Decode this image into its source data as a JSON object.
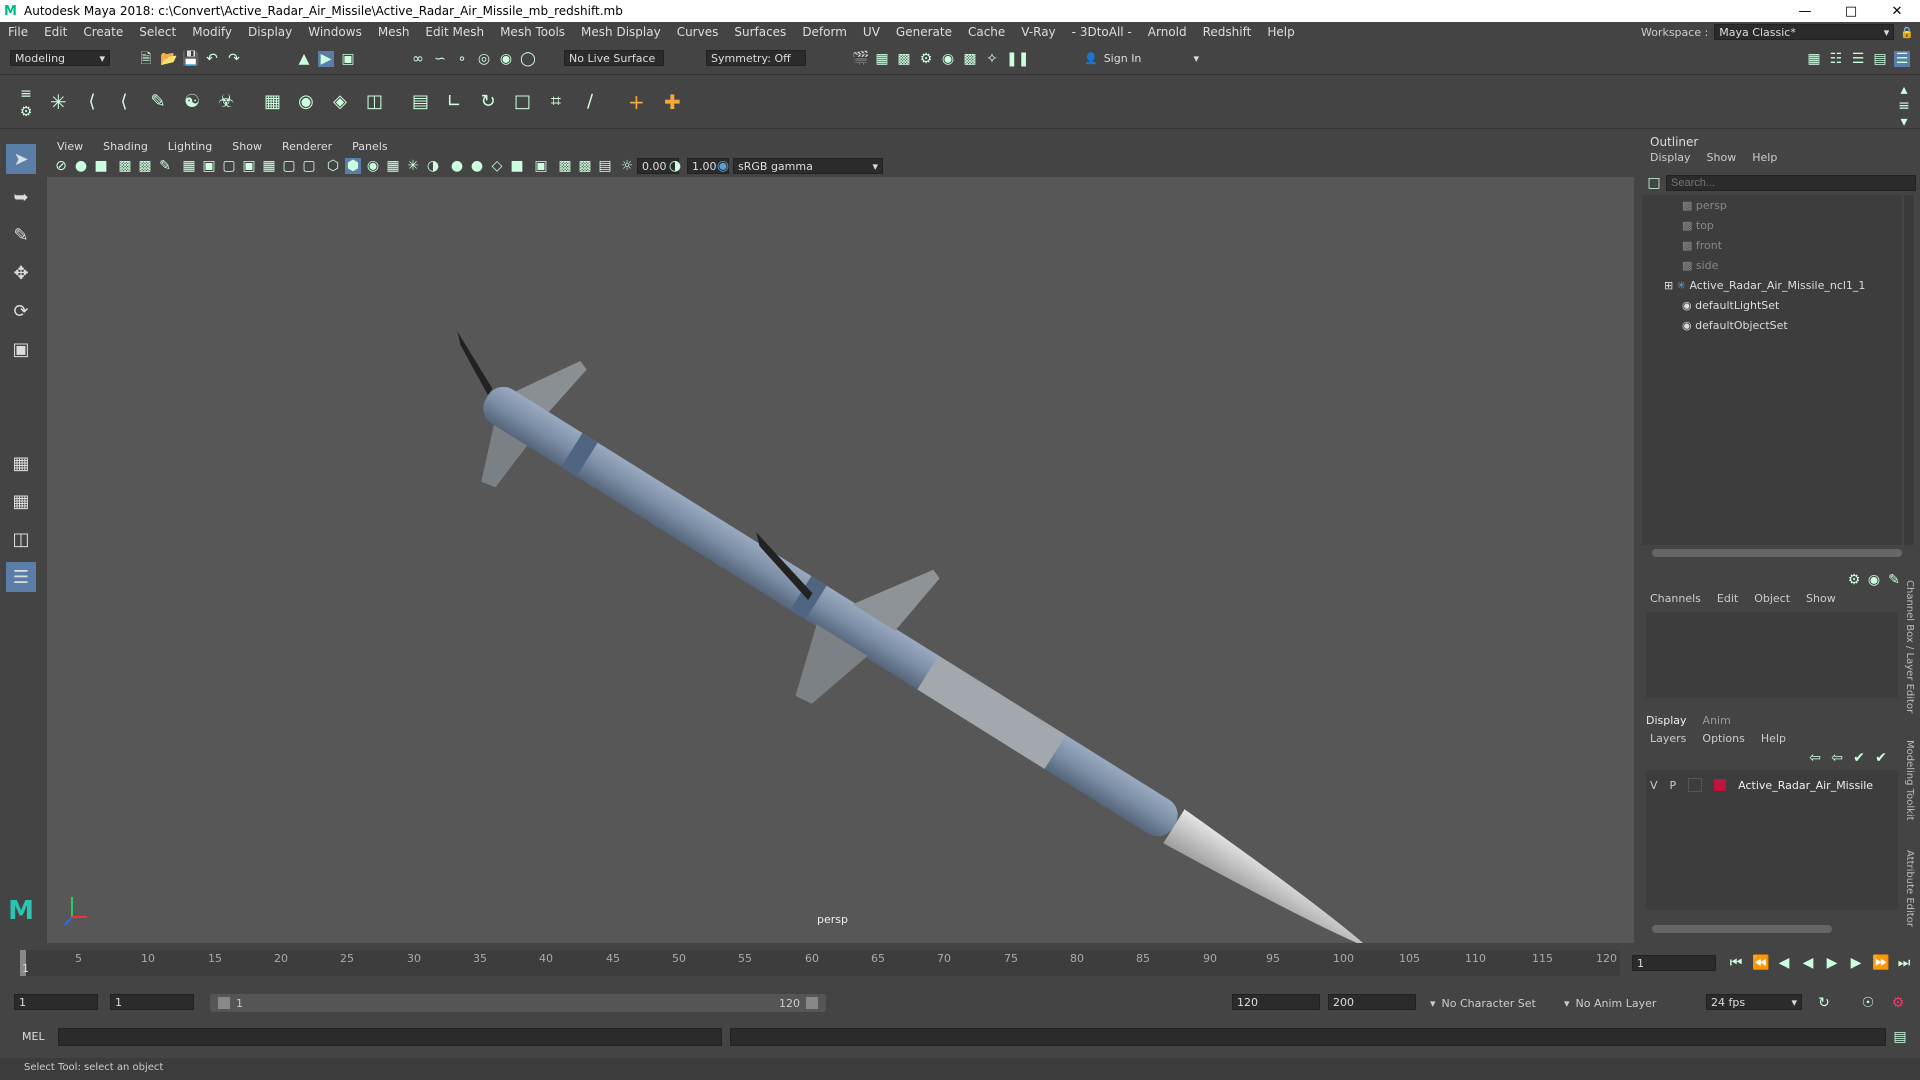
{
  "window": {
    "title": "Autodesk Maya 2018: c:\\Convert\\Active_Radar_Air_Missile\\Active_Radar_Air_Missile_mb_redshift.mb",
    "logo": "M"
  },
  "menus": [
    "File",
    "Edit",
    "Create",
    "Select",
    "Modify",
    "Display",
    "Windows",
    "Mesh",
    "Edit Mesh",
    "Mesh Tools",
    "Mesh Display",
    "Curves",
    "Surfaces",
    "Deform",
    "UV",
    "Generate",
    "Cache",
    "V-Ray",
    "- 3DtoAll -",
    "Arnold",
    "Redshift",
    "Help"
  ],
  "workspace": {
    "label": "Workspace :",
    "value": "Maya Classic*"
  },
  "status_line": {
    "mode": "Modeling",
    "live_surface": "No Live Surface",
    "symmetry": "Symmetry: Off",
    "sign_in": "Sign In"
  },
  "viewport": {
    "menu": [
      "View",
      "Shading",
      "Lighting",
      "Show",
      "Renderer",
      "Panels"
    ],
    "exposure": "0.00",
    "gamma": "1.00",
    "color_space": "sRGB gamma",
    "camera_label": "persp"
  },
  "outliner": {
    "title": "Outliner",
    "menu": [
      "Display",
      "Show",
      "Help"
    ],
    "search_placeholder": "Search...",
    "items": [
      "persp",
      "top",
      "front",
      "side",
      "Active_Radar_Air_Missile_ncl1_1",
      "defaultLightSet",
      "defaultObjectSet"
    ]
  },
  "channel_box": {
    "menu": [
      "Channels",
      "Edit",
      "Object",
      "Show"
    ]
  },
  "layer_editor": {
    "tabs": [
      "Display",
      "Anim"
    ],
    "menu": [
      "Layers",
      "Options",
      "Help"
    ],
    "layer": {
      "v": "V",
      "p": "P",
      "name": "Active_Radar_Air_Missile",
      "color": "#c0143c"
    }
  },
  "side_tabs": [
    "Channel Box / Layer Editor",
    "Modeling Toolkit",
    "Attribute Editor"
  ],
  "timeline": {
    "ticks": [
      "1",
      "5",
      "10",
      "15",
      "20",
      "25",
      "30",
      "35",
      "40",
      "45",
      "50",
      "55",
      "60",
      "65",
      "70",
      "75",
      "80",
      "85",
      "90",
      "95",
      "100",
      "105",
      "110",
      "115",
      "120"
    ],
    "current_frame": "1"
  },
  "range": {
    "start": "1",
    "playback_start": "1",
    "slider_start": "1",
    "slider_end": "120",
    "playback_end": "120",
    "end": "200",
    "character_set": "No Character Set",
    "anim_layer": "No Anim Layer",
    "fps": "24 fps"
  },
  "command_line": {
    "label": "MEL"
  },
  "help_line": {
    "text": "Select Tool: select an object"
  },
  "colors": {
    "accent": "#5aa0d8",
    "missile_body": "#7c8ea6",
    "nose": "#cfcfcf"
  }
}
